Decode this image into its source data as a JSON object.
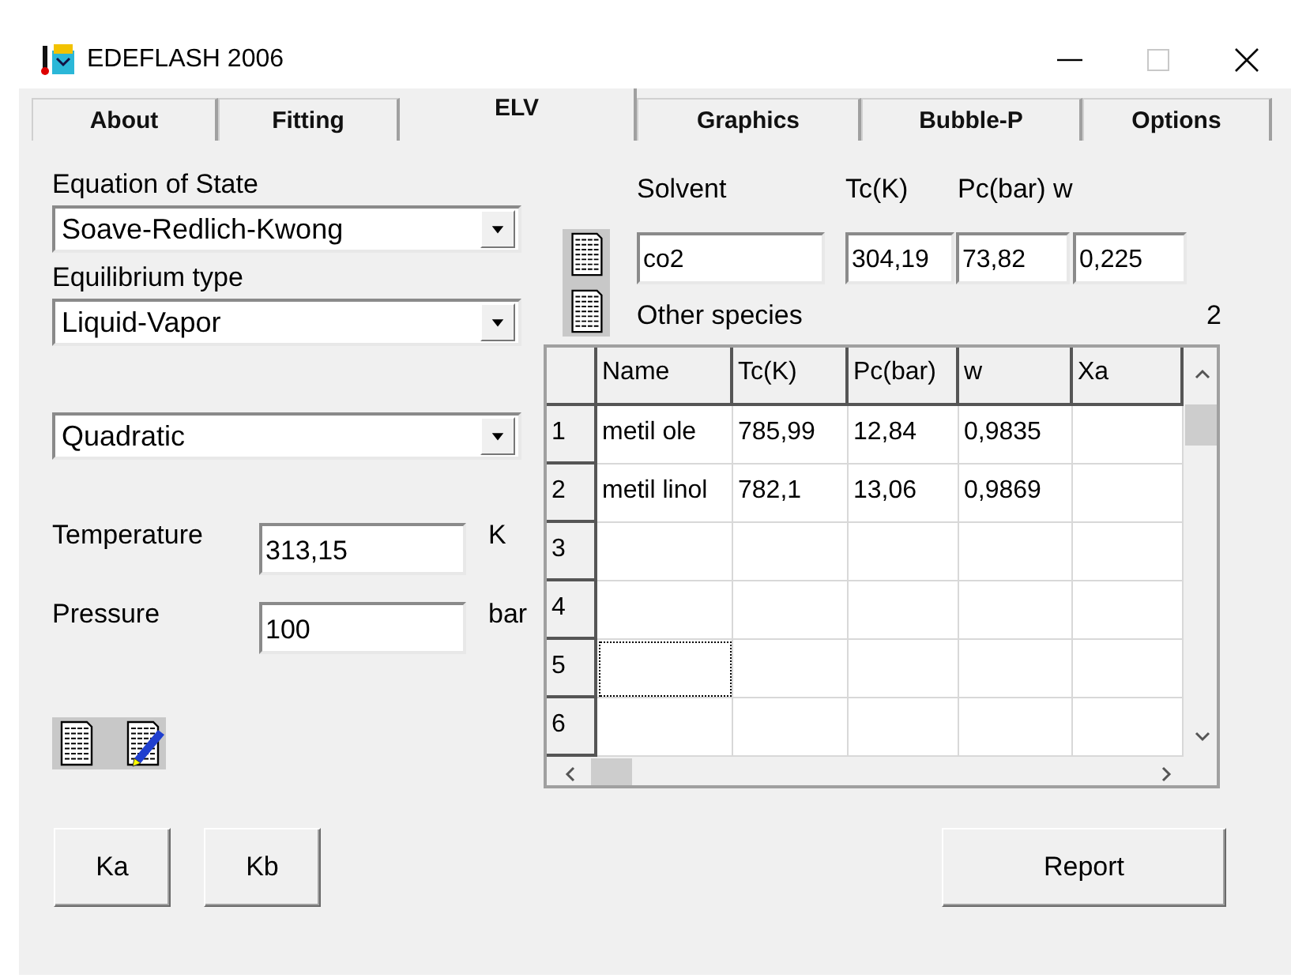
{
  "window": {
    "title": "EDEFLASH 2006"
  },
  "tabs": [
    {
      "label": "About",
      "selected": false
    },
    {
      "label": "Fitting",
      "selected": false
    },
    {
      "label": "ELV",
      "selected": true
    },
    {
      "label": "Graphics",
      "selected": false
    },
    {
      "label": "Bubble-P",
      "selected": false
    },
    {
      "label": "Options",
      "selected": false
    }
  ],
  "equation_of_state": {
    "label": "Equation of State",
    "value": "Soave-Redlich-Kwong"
  },
  "equilibrium_type": {
    "label": "Equilibrium type",
    "value": "Liquid-Vapor"
  },
  "mixing_rule": {
    "value": "Quadratic"
  },
  "temperature": {
    "label": "Temperature",
    "value": "313,15",
    "unit": "K"
  },
  "pressure": {
    "label": "Pressure",
    "value": "100",
    "unit": "bar"
  },
  "solvent": {
    "label": "Solvent",
    "tc_label": "Tc(K)",
    "pc_w_label": "Pc(bar) w",
    "name": "co2",
    "tc": "304,19",
    "pc": "73,82",
    "w": "0,225"
  },
  "other_species": {
    "label": "Other species",
    "count": "2"
  },
  "table": {
    "columns": [
      "Name",
      "Tc(K)",
      "Pc(bar)",
      "w",
      "Xa"
    ],
    "rows": [
      {
        "number": "1",
        "cells": [
          "metil ole",
          "785,99",
          "12,84",
          "0,9835"
        ],
        "focused": false
      },
      {
        "number": "2",
        "cells": [
          "metil linol",
          "782,1",
          "13,06",
          "0,9869"
        ],
        "focused": false
      },
      {
        "number": "3",
        "focused": false
      },
      {
        "number": "4",
        "focused": false
      },
      {
        "number": "5",
        "focused": true
      },
      {
        "number": "6",
        "focused": false
      }
    ]
  },
  "buttons": [
    "Ka",
    "Kb",
    "Report"
  ]
}
